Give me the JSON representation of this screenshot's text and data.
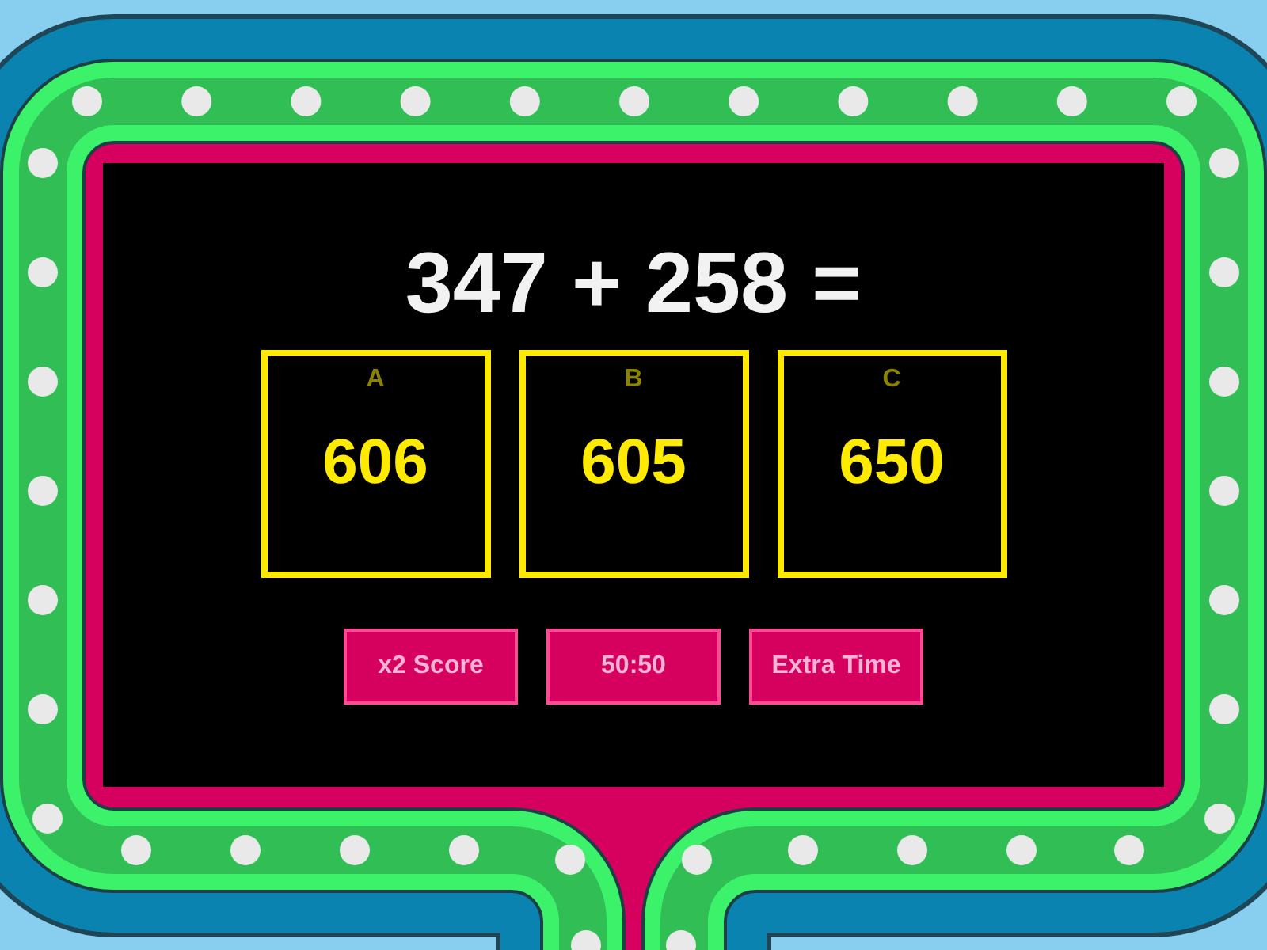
{
  "question": "347 + 258 =",
  "answers": [
    {
      "letter": "A",
      "value": "606"
    },
    {
      "letter": "B",
      "value": "605"
    },
    {
      "letter": "C",
      "value": "650"
    }
  ],
  "powerups": [
    "x2 Score",
    "50:50",
    "Extra Time"
  ]
}
